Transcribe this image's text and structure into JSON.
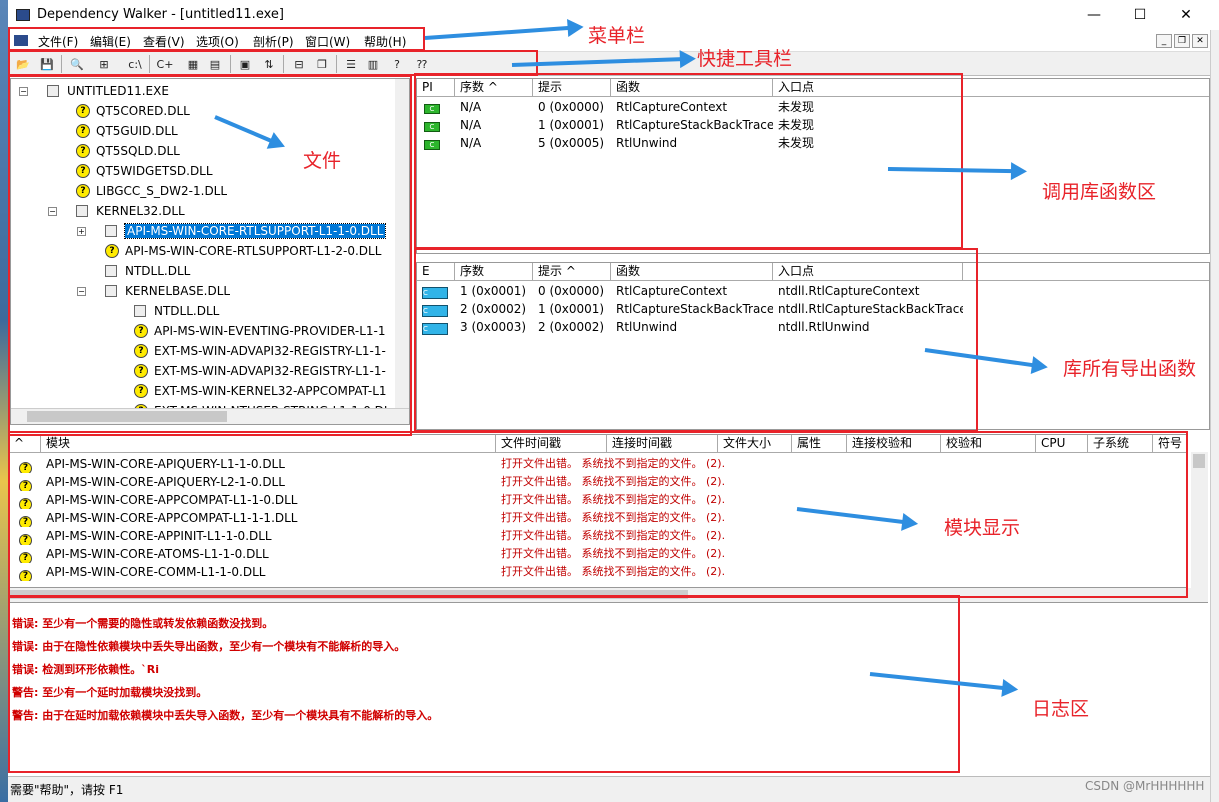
{
  "window": {
    "title": "Dependency Walker - [untitled11.exe]",
    "minimize": "—",
    "maximize": "☐",
    "close": "✕"
  },
  "menu": [
    "文件(F)",
    "编辑(E)",
    "查看(V)",
    "选项(O)",
    "剖析(P)",
    "窗口(W)",
    "帮助(H)"
  ],
  "toolbar_icons": [
    "open-icon",
    "save-icon",
    "find-icon",
    "copy-tree-icon",
    "full-paths-icon",
    "undecorate-cpp-icon",
    "view-module-icon",
    "properties-icon",
    "system-info-icon",
    "sort-icon",
    "auto-expand-icon",
    "cascade-icon",
    "tile-horizontal-icon",
    "tile-vertical-icon",
    "help-context-icon"
  ],
  "toolbar_glyphs": [
    "📂",
    "💾",
    "🔍",
    "⊞",
    "c:\\",
    "C+",
    "▦",
    "▤",
    "▣",
    "⇅",
    "⊟",
    "❐",
    "☰",
    "▥",
    "?"
  ],
  "tree": [
    {
      "label": "UNTITLED11.EXE",
      "icon": "square",
      "level": 0,
      "expander": "−"
    },
    {
      "label": "QT5CORED.DLL",
      "icon": "question",
      "level": 1
    },
    {
      "label": "QT5GUID.DLL",
      "icon": "question",
      "level": 1
    },
    {
      "label": "QT5SQLD.DLL",
      "icon": "question",
      "level": 1
    },
    {
      "label": "QT5WIDGETSD.DLL",
      "icon": "question",
      "level": 1
    },
    {
      "label": "LIBGCC_S_DW2-1.DLL",
      "icon": "question",
      "level": 1
    },
    {
      "label": "KERNEL32.DLL",
      "icon": "square",
      "level": 1,
      "expander": "−"
    },
    {
      "label": "API-MS-WIN-CORE-RTLSUPPORT-L1-1-0.DLL",
      "icon": "square",
      "level": 2,
      "expander": "+",
      "selected": true
    },
    {
      "label": "API-MS-WIN-CORE-RTLSUPPORT-L1-2-0.DLL",
      "icon": "question",
      "level": 2
    },
    {
      "label": "NTDLL.DLL",
      "icon": "square",
      "level": 2
    },
    {
      "label": "KERNELBASE.DLL",
      "icon": "square",
      "level": 2,
      "expander": "−"
    },
    {
      "label": "NTDLL.DLL",
      "icon": "square",
      "level": 3
    },
    {
      "label": "API-MS-WIN-EVENTING-PROVIDER-L1-1",
      "icon": "question",
      "level": 3
    },
    {
      "label": "EXT-MS-WIN-ADVAPI32-REGISTRY-L1-1-",
      "icon": "question",
      "level": 3
    },
    {
      "label": "EXT-MS-WIN-ADVAPI32-REGISTRY-L1-1-",
      "icon": "question",
      "level": 3
    },
    {
      "label": "EXT-MS-WIN-KERNEL32-APPCOMPAT-L1",
      "icon": "question",
      "level": 3
    },
    {
      "label": "EXT-MS-WIN-NTUSER-STRING-L1-1-0.DL",
      "icon": "question",
      "level": 3
    }
  ],
  "imports": {
    "headers": [
      "PI",
      "序数 ^",
      "提示",
      "函数",
      "入口点"
    ],
    "rows": [
      [
        "N/A",
        "0 (0x0000)",
        "RtlCaptureContext",
        "未发现"
      ],
      [
        "N/A",
        "1 (0x0001)",
        "RtlCaptureStackBackTrace",
        "未发现"
      ],
      [
        "N/A",
        "5 (0x0005)",
        "RtlUnwind",
        "未发现"
      ]
    ]
  },
  "exports": {
    "headers": [
      "E",
      "序数",
      "提示 ^",
      "函数",
      "入口点"
    ],
    "rows": [
      [
        "1 (0x0001)",
        "0 (0x0000)",
        "RtlCaptureContext",
        "ntdll.RtlCaptureContext"
      ],
      [
        "2 (0x0002)",
        "1 (0x0001)",
        "RtlCaptureStackBackTrace",
        "ntdll.RtlCaptureStackBackTrace"
      ],
      [
        "3 (0x0003)",
        "2 (0x0002)",
        "RtlUnwind",
        "ntdll.RtlUnwind"
      ]
    ]
  },
  "modules": {
    "headers": [
      "^",
      "模块",
      "文件时间戳",
      "连接时间戳",
      "文件大小",
      "属性",
      "连接校验和",
      "校验和",
      "CPU",
      "子系统",
      "符号"
    ],
    "error_text": "打开文件出错。 系统找不到指定的文件。 (2).",
    "rows": [
      "API-MS-WIN-CORE-APIQUERY-L1-1-0.DLL",
      "API-MS-WIN-CORE-APIQUERY-L2-1-0.DLL",
      "API-MS-WIN-CORE-APPCOMPAT-L1-1-0.DLL",
      "API-MS-WIN-CORE-APPCOMPAT-L1-1-1.DLL",
      "API-MS-WIN-CORE-APPINIT-L1-1-0.DLL",
      "API-MS-WIN-CORE-ATOMS-L1-1-0.DLL",
      "API-MS-WIN-CORE-COMM-L1-1-0.DLL"
    ]
  },
  "log": [
    "错误: 至少有一个需要的隐性或转发依赖函数没找到。",
    "错误: 由于在隐性依赖模块中丢失导出函数，至少有一个模块有不能解析的导入。",
    "错误: 检测到环形依赖性。`Ri",
    "警告: 至少有一个延时加载模块没找到。",
    "警告: 由于在延时加载依赖模块中丢失导入函数，至少有一个模块具有不能解析的导入。"
  ],
  "statusbar": "需要\"帮助\"，请按 F1",
  "annotations": {
    "menu": "菜单栏",
    "toolbar": "快捷工具栏",
    "files": "文件",
    "imports": "调用库函数区",
    "exports": "库所有导出函数",
    "modules": "模块显示",
    "log": "日志区"
  },
  "watermark": "CSDN @MrHHHHHH",
  "colors": {
    "annotation_red": "#e8232a",
    "arrow_blue": "#2e8ee0",
    "selection": "#0078d7",
    "error_red": "#c00000"
  }
}
